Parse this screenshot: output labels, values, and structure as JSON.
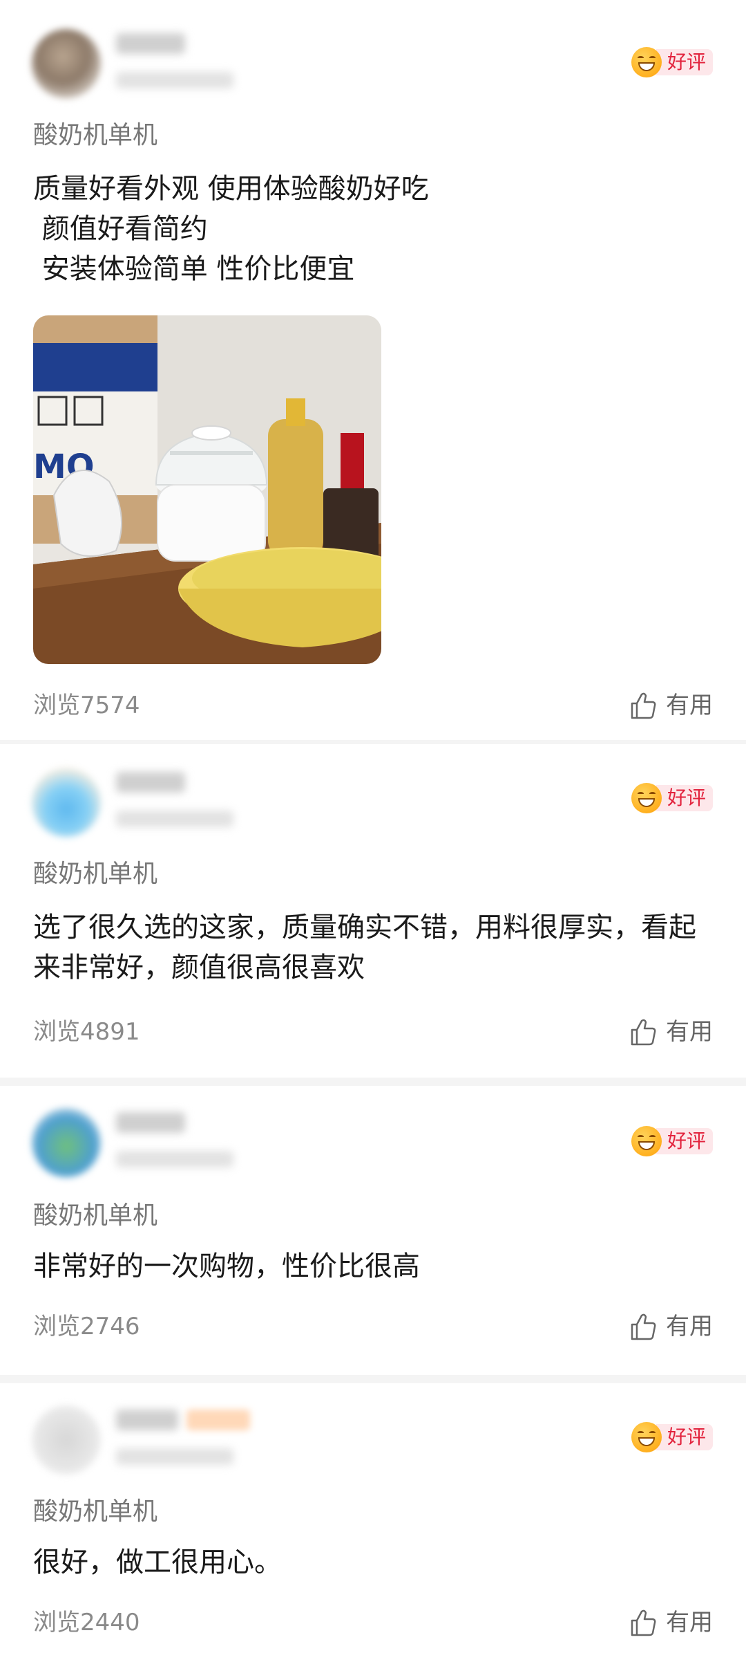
{
  "reviews": [
    {
      "badge_label": "好评",
      "spec": "酸奶机单机",
      "content_lines": [
        "质量好看外观 使用体验酸奶好吃",
        " 颜值好看简约",
        " 安装体验简单 性价比便宜"
      ],
      "views": "浏览7574",
      "useful_label": "有用"
    },
    {
      "badge_label": "好评",
      "spec": "酸奶机单机",
      "content": "选了很久选的这家，质量确实不错，用料很厚实，看起来非常好，颜值很高很喜欢",
      "views": "浏览4891",
      "useful_label": "有用"
    },
    {
      "badge_label": "好评",
      "spec": "酸奶机单机",
      "content": "非常好的一次购物，性价比很高",
      "views": "浏览2746",
      "useful_label": "有用"
    },
    {
      "badge_label": "好评",
      "spec": "酸奶机单机",
      "content": "很好，做工很用心。",
      "views": "浏览2440",
      "useful_label": "有用"
    }
  ],
  "icons": {
    "badge": "smiling-face-icon",
    "useful": "thumbs-up-icon"
  },
  "colors": {
    "badge_text": "#e2233d",
    "badge_bg": "#fde7ea",
    "secondary_text": "#8a8a8a"
  }
}
